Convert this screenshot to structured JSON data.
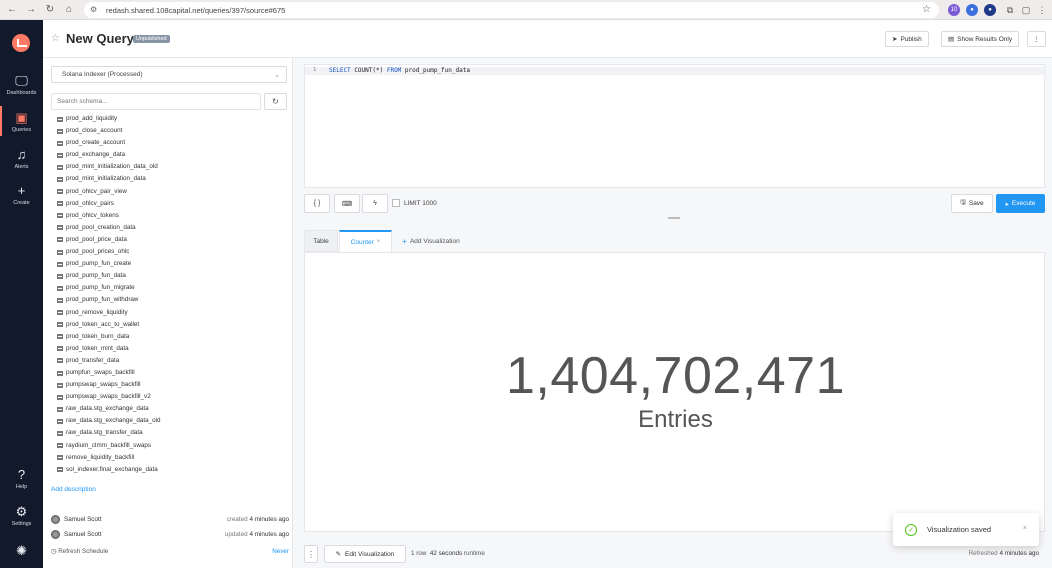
{
  "browser": {
    "url": "redash.shared.108capital.net/queries/397/source#675",
    "ext_badge": "10"
  },
  "nav": {
    "items": [
      {
        "label": "Dashboards",
        "icon": "monitor-icon"
      },
      {
        "label": "Queries",
        "icon": "terminal-icon"
      },
      {
        "label": "Alerts",
        "icon": "bell-icon"
      },
      {
        "label": "Create",
        "icon": "plus-icon"
      },
      {
        "label": "Help",
        "icon": "help-icon"
      },
      {
        "label": "Settings",
        "icon": "gear-icon"
      }
    ]
  },
  "header": {
    "title": "New Query",
    "badge": "Unpublished",
    "publish_label": "Publish",
    "show_results_label": "Show Results Only"
  },
  "schema": {
    "datasource": "Solana Indexer (Processed)",
    "search_placeholder": "Search schema...",
    "tables": [
      "prod_add_liquidity",
      "prod_close_account",
      "prod_create_account",
      "prod_exchange_data",
      "prod_mint_initialization_data_old",
      "prod_mint_initialization_data",
      "prod_ohlcv_pair_view",
      "prod_ohlcv_pairs",
      "prod_ohlcv_tokens",
      "prod_pool_creation_data",
      "prod_pool_price_data",
      "prod_pool_prices_ohlc",
      "prod_pump_fun_create",
      "prod_pump_fun_data",
      "prod_pump_fun_migrate",
      "prod_pump_fun_withdraw",
      "prod_remove_liquidity",
      "prod_token_acc_to_wallet",
      "prod_token_burn_data",
      "prod_token_mint_data",
      "prod_transfer_data",
      "pumpfun_swaps_backfill",
      "pumpswap_swaps_backfill",
      "pumpswap_swaps_backfill_v2",
      "raw_data.stg_exchange_data",
      "raw_data.stg_exchange_data_old",
      "raw_data.stg_transfer_data",
      "raydium_clmm_backfill_swaps",
      "remove_liquidity_backfill",
      "sol_indexer.final_exchange_data"
    ],
    "add_description": "Add description",
    "created": {
      "user": "Samuel Scott",
      "prefix": "created",
      "time": "4 minutes ago"
    },
    "updated": {
      "user": "Samuel Scott",
      "prefix": "updated",
      "time": "4 minutes ago"
    },
    "refresh_schedule_label": "Refresh Schedule",
    "refresh_schedule_value": "Never"
  },
  "editor": {
    "line_number": "1",
    "keyword_select": "SELECT",
    "fn_count": "COUNT(*)",
    "keyword_from": "FROM",
    "table": "prod_pump_fun_data",
    "format_label": "{ }",
    "limit_label": "LIMIT 1000",
    "save_label": "Save",
    "execute_label": "Execute"
  },
  "viz": {
    "tab_table": "Table",
    "tab_counter": "Counter",
    "add_label": "Add Visualization",
    "counter_value": "1,404,702,471",
    "counter_label": "Entries"
  },
  "footer": {
    "edit_viz_label": "Edit Visualization",
    "rows": "1 row",
    "seconds": "42 seconds",
    "runtime": "runtime",
    "refreshed_prefix": "Refreshed",
    "refreshed_time": "4 minutes ago"
  },
  "toast": {
    "message": "Visualization saved"
  },
  "colors": {
    "accent": "#2196f3",
    "brand": "#ff7964",
    "nav_bg": "#11192b",
    "success": "#52c41a"
  }
}
